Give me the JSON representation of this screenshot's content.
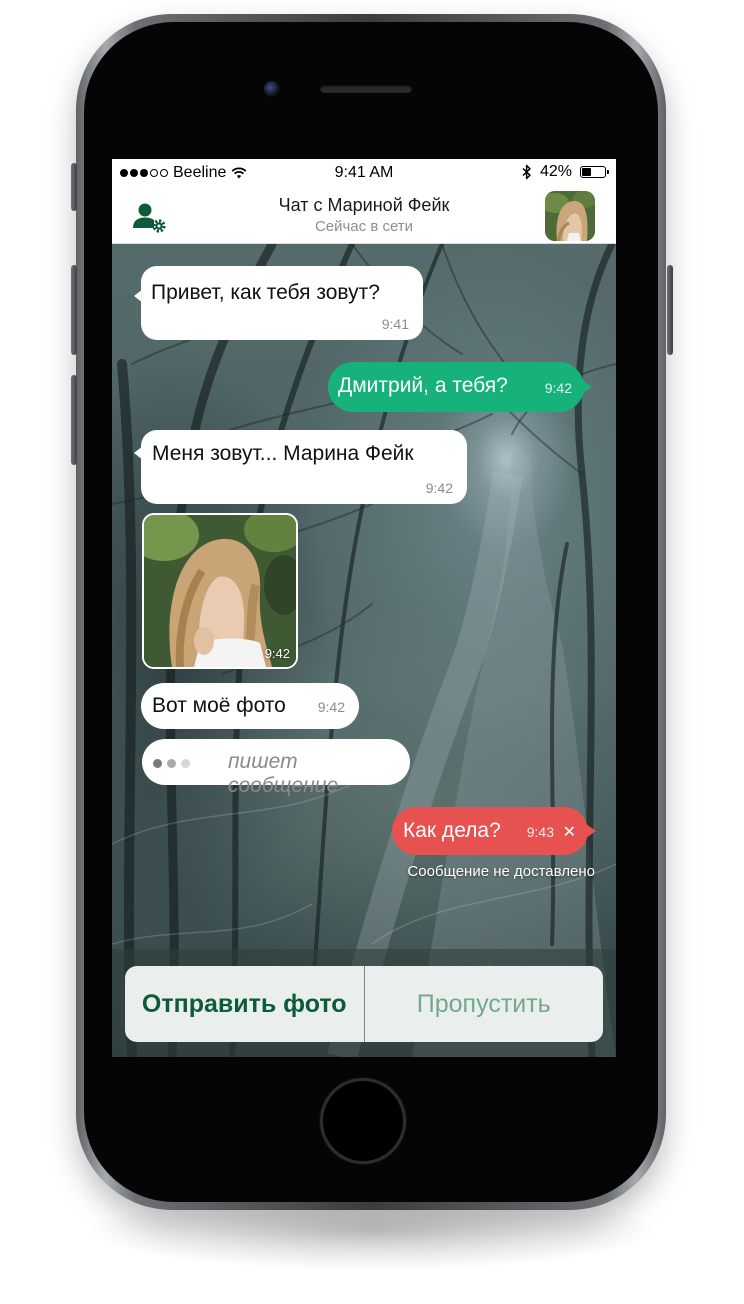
{
  "status_bar": {
    "carrier": "Beeline",
    "time": "9:41 AM",
    "battery_percent": "42%",
    "battery_level": 0.42,
    "signal_bars_filled": 3,
    "signal_bars_total": 5,
    "icons": [
      "wifi-icon",
      "bluetooth-icon",
      "battery-icon"
    ]
  },
  "chat_header": {
    "title": "Чат с Мариной Фейк",
    "status": "Сейчас в сети",
    "left_icon": "user-settings-icon",
    "accent_color": "#0e5b3a"
  },
  "messages": [
    {
      "direction": "incoming",
      "text": "Привет, как тебя зовут?",
      "time": "9:41"
    },
    {
      "direction": "outgoing",
      "text": "Дмитрий, а тебя?",
      "time": "9:42"
    },
    {
      "direction": "incoming",
      "text": "Меня зовут... Марина Фейк",
      "time": "9:42"
    },
    {
      "direction": "incoming",
      "type": "photo",
      "time": "9:42"
    },
    {
      "direction": "incoming",
      "text": "Вот моё фото",
      "time": "9:42"
    },
    {
      "direction": "outgoing",
      "text": "Как дела?",
      "time": "9:43",
      "failed": true
    }
  ],
  "typing_indicator": {
    "text": "пишет сообщение"
  },
  "failed_notice": "Сообщение не доставлено",
  "actions": {
    "send_photo": "Отправить фото",
    "skip": "Пропустить"
  },
  "colors": {
    "outgoing_bubble": "#16b27a",
    "failed_bubble": "#e7514f",
    "incoming_bubble": "#ffffff",
    "primary_action": "#0e5b3a",
    "secondary_action": "#72a98d"
  }
}
